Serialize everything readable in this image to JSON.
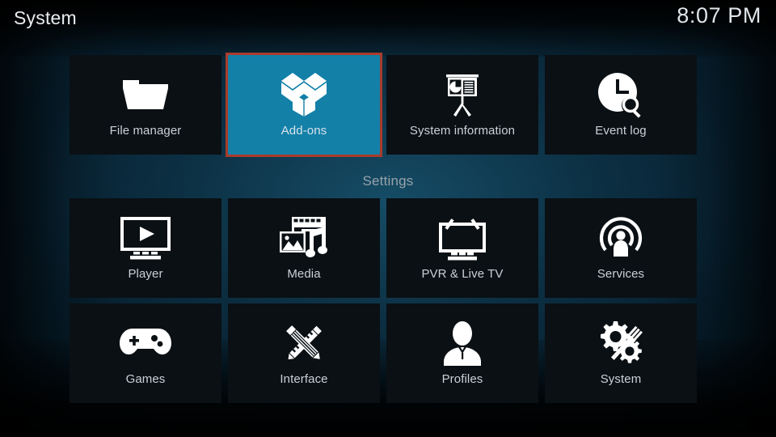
{
  "header": {
    "title": "System",
    "clock": "8:07 PM"
  },
  "sections": {
    "settings_heading": "Settings"
  },
  "colors": {
    "focus_fill": "#1380a8",
    "focus_border": "#a93c2b",
    "tile_fill": "#0a1014",
    "label": "#c9d2d8",
    "heading": "#97a3ab",
    "title": "#e9edf0"
  },
  "rows": [
    {
      "name": "top-row",
      "tiles": [
        {
          "label": "File manager",
          "icon": "folder-icon",
          "focused": false
        },
        {
          "label": "Add-ons",
          "icon": "open-box-icon",
          "focused": true
        },
        {
          "label": "System information",
          "icon": "presentation-icon",
          "focused": false
        },
        {
          "label": "Event log",
          "icon": "clock-search-icon",
          "focused": false
        }
      ]
    },
    {
      "name": "settings-row-1",
      "tiles": [
        {
          "label": "Player",
          "icon": "monitor-play-icon",
          "focused": false
        },
        {
          "label": "Media",
          "icon": "media-stack-icon",
          "focused": false
        },
        {
          "label": "PVR & Live TV",
          "icon": "tv-antenna-icon",
          "focused": false
        },
        {
          "label": "Services",
          "icon": "broadcast-icon",
          "focused": false
        }
      ]
    },
    {
      "name": "settings-row-2",
      "tiles": [
        {
          "label": "Games",
          "icon": "gamepad-icon",
          "focused": false
        },
        {
          "label": "Interface",
          "icon": "pencil-ruler-icon",
          "focused": false
        },
        {
          "label": "Profiles",
          "icon": "person-icon",
          "focused": false
        },
        {
          "label": "System",
          "icon": "gears-wrench-icon",
          "focused": false
        }
      ]
    }
  ]
}
